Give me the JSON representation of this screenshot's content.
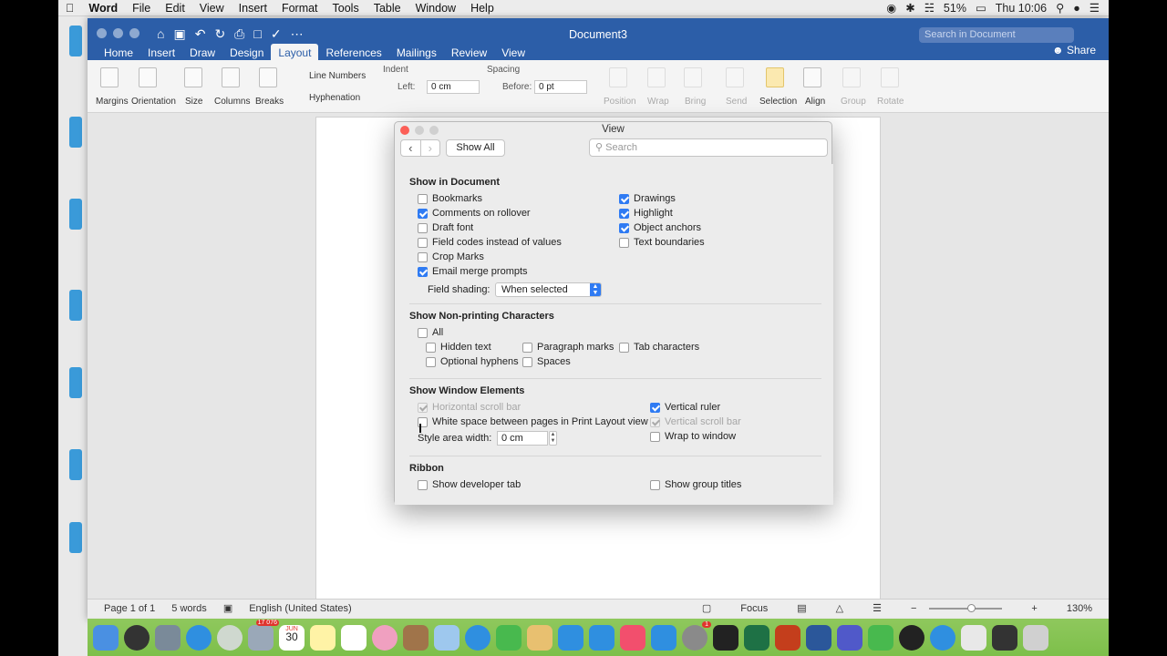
{
  "menubar": {
    "app": "Word",
    "items": [
      "File",
      "Edit",
      "View",
      "Insert",
      "Format",
      "Tools",
      "Table",
      "Window",
      "Help"
    ],
    "battery": "51%",
    "clock": "Thu 10:06"
  },
  "word": {
    "doc_title": "Document3",
    "search_placeholder": "Search in Document",
    "share": "Share",
    "tabs": [
      "Home",
      "Insert",
      "Draw",
      "Design",
      "Layout",
      "References",
      "Mailings",
      "Review",
      "View"
    ],
    "active_tab": "Layout",
    "ribbon": {
      "margins": "Margins",
      "orientation": "Orientation",
      "size": "Size",
      "columns": "Columns",
      "breaks": "Breaks",
      "line_numbers": "Line Numbers",
      "hyphenation": "Hyphenation",
      "indent": "Indent",
      "indent_left_label": "Left:",
      "indent_left_value": "0 cm",
      "spacing": "Spacing",
      "spacing_before_label": "Before:",
      "spacing_before_value": "0 pt",
      "position": "Position",
      "wrap": "Wrap",
      "bring": "Bring",
      "send": "Send",
      "selection": "Selection",
      "align": "Align",
      "group": "Group",
      "rotate": "Rotate"
    },
    "status": {
      "page": "Page 1 of 1",
      "words": "5 words",
      "language": "English (United States)",
      "focus": "Focus",
      "zoom": "130%"
    }
  },
  "dialog": {
    "title": "View",
    "show_all": "Show All",
    "search_placeholder": "Search",
    "show_in_document": {
      "heading": "Show in Document",
      "bookmarks": "Bookmarks",
      "comments_on_rollover": "Comments on rollover",
      "draft_font": "Draft font",
      "field_codes": "Field codes instead of values",
      "crop_marks": "Crop Marks",
      "email_merge_prompts": "Email merge prompts",
      "drawings": "Drawings",
      "highlight": "Highlight",
      "object_anchors": "Object anchors",
      "text_boundaries": "Text boundaries",
      "field_shading_label": "Field shading:",
      "field_shading_value": "When selected"
    },
    "non_printing": {
      "heading": "Show Non-printing Characters",
      "all": "All",
      "hidden_text": "Hidden text",
      "paragraph_marks": "Paragraph marks",
      "tab_characters": "Tab characters",
      "optional_hyphens": "Optional hyphens",
      "spaces": "Spaces"
    },
    "window_elements": {
      "heading": "Show Window Elements",
      "horizontal_scroll_bar": "Horizontal scroll bar",
      "white_space": "White space between pages in Print Layout view",
      "vertical_ruler": "Vertical ruler",
      "vertical_scroll_bar": "Vertical scroll bar",
      "wrap_to_window": "Wrap to window",
      "style_area_label": "Style area width:",
      "style_area_value": "0 cm"
    },
    "ribbon": {
      "heading": "Ribbon",
      "show_developer_tab": "Show developer tab",
      "show_group_titles": "Show group titles"
    }
  },
  "dock": {
    "calendar_month": "JUN",
    "calendar_day": "30",
    "mail_badge": "17 076",
    "appstore_badge": "1"
  },
  "colors": {
    "word_blue": "#2c5ea8",
    "checkbox_blue": "#2f7bf3",
    "dock_green": "#84c350"
  }
}
